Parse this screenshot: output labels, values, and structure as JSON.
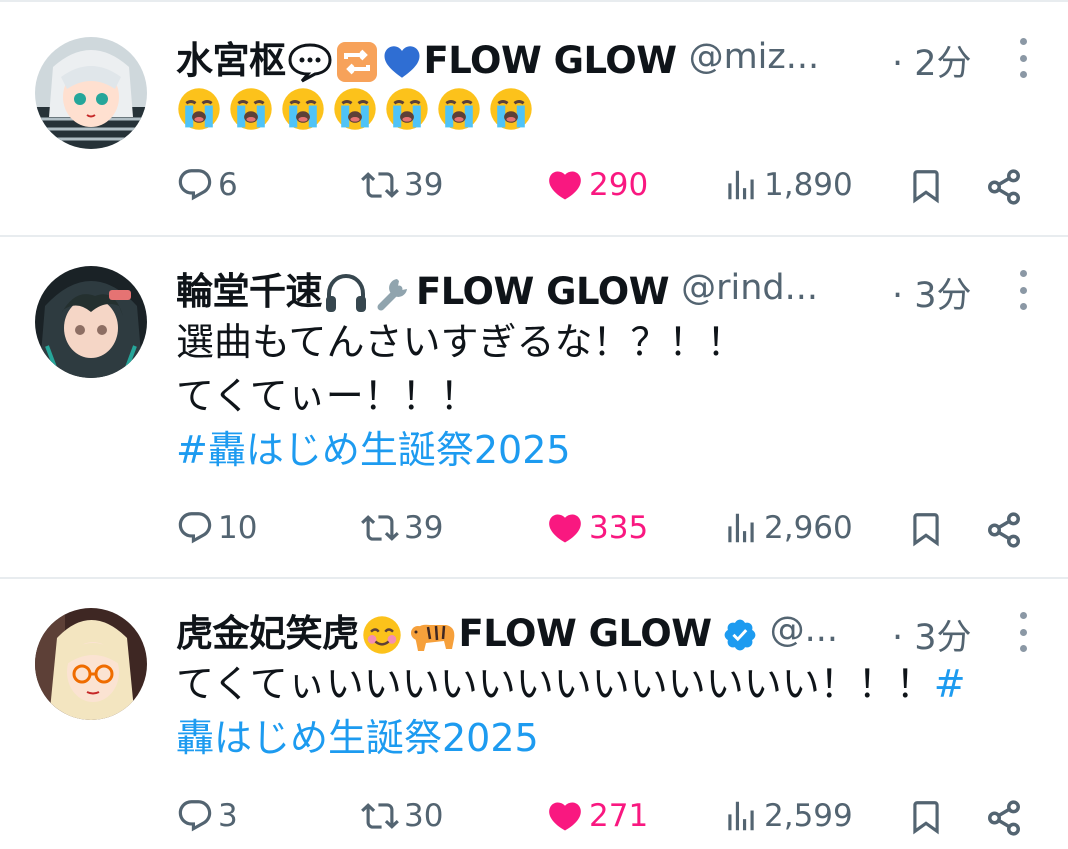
{
  "tweets": [
    {
      "name": "水宮枢",
      "name_suffix": "FLOW GLOW",
      "handle": "@miz...",
      "time": "· 2分",
      "emoji_icons": [
        "speech-balloon-icon",
        "repeat-button-icon",
        "blue-heart-icon"
      ],
      "body_emoji_count": 7,
      "body_emoji": "loudly-crying-face-icon",
      "replies": "6",
      "reposts": "39",
      "likes": "290",
      "views": "1,890"
    },
    {
      "name": "輪堂千速",
      "name_suffix": "FLOW GLOW",
      "handle": "@rind...",
      "time": "· 3分",
      "emoji_icons": [
        "headphone-icon",
        "wrench-icon"
      ],
      "text_line1": "選曲もてんさいすぎるな！？！！",
      "text_line2": "てくてぃー！！！",
      "hashtag": "#轟はじめ生誕祭2025",
      "replies": "10",
      "reposts": "39",
      "likes": "335",
      "views": "2,960"
    },
    {
      "name": "虎金妃笑虎",
      "name_suffix": "FLOW GLOW",
      "handle": "@...",
      "time": "· 3分",
      "emoji_icons": [
        "smiling-face-icon",
        "tiger-icon",
        "verified-badge-icon"
      ],
      "text_line1": "てくてぃいいいいいいいいいいいいい！！！",
      "hashtag_start": "#",
      "hashtag_rest": "轟はじめ生誕祭2025",
      "replies": "3",
      "reposts": "30",
      "likes": "271",
      "views": "2,599"
    }
  ],
  "colors": {
    "text": "#0f1419",
    "secondary": "#536471",
    "like": "#f91880",
    "link": "#1d9bf0",
    "divider": "#e8ecef"
  }
}
